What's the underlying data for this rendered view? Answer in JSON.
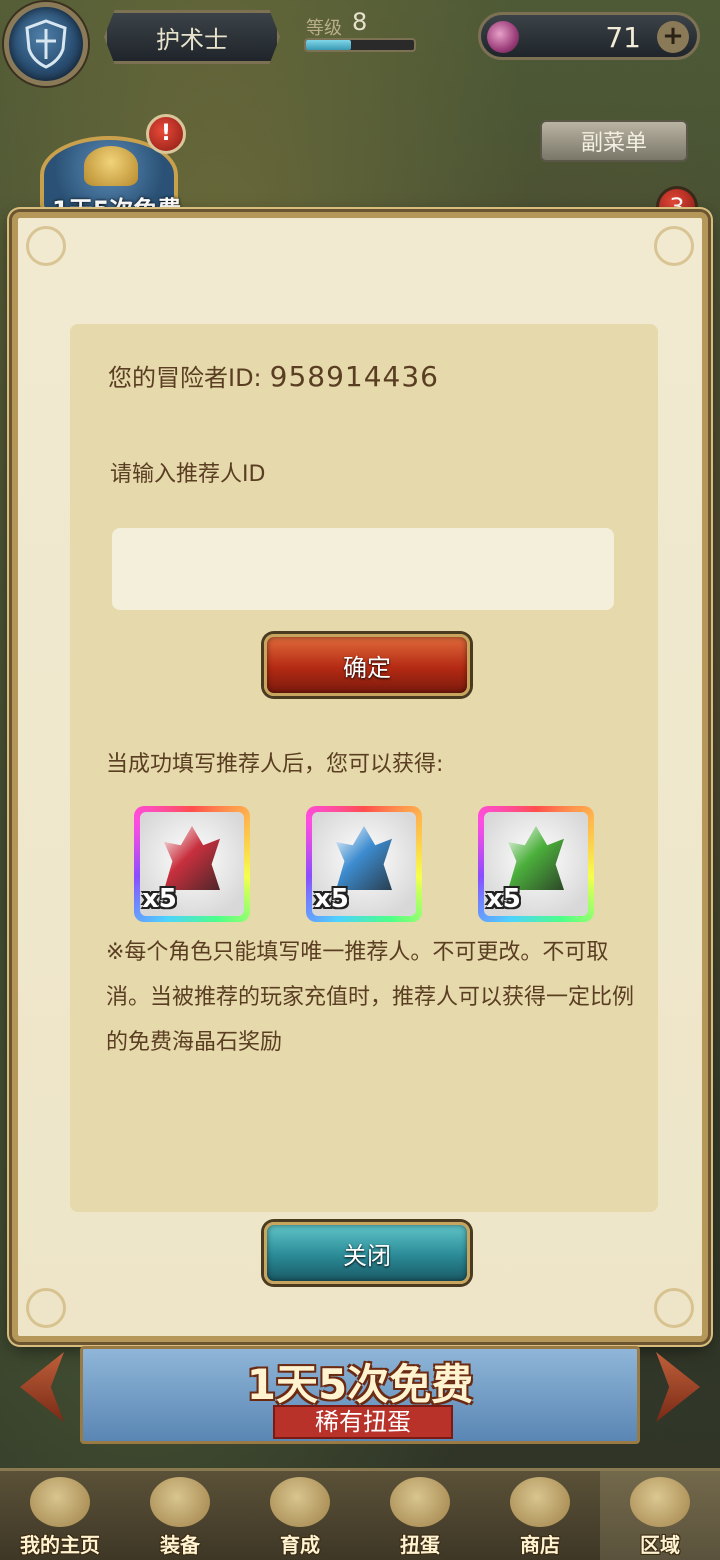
{
  "hud": {
    "player_class": "护术士",
    "level_label": "等级",
    "level_value": "8",
    "level_progress": 0.42,
    "gem_count": "71",
    "gem_add_symbol": "+",
    "free_badge": "1天5次免费",
    "alert_symbol": "!",
    "submenu_label": "副菜单",
    "notification_count": "3"
  },
  "referral": {
    "id_label": "您的冒险者ID:",
    "id_value": "958914436",
    "input_label": "请输入推荐人ID",
    "input_value": "",
    "input_placeholder": "",
    "confirm_label": "确定",
    "reward_intro": "当成功填写推荐人后，您可以获得:",
    "rewards": [
      {
        "name": "red-crystal",
        "quantity": "x5",
        "color": "#c8303e"
      },
      {
        "name": "blue-crystal",
        "quantity": "x5",
        "color": "#3d8ccf"
      },
      {
        "name": "green-crystal",
        "quantity": "x5",
        "color": "#4cb03c"
      }
    ],
    "note": "※每个角色只能填写唯一推荐人。不可更改。不可取消。当被推荐的玩家充值时，推荐人可以获得一定比例的免费海晶石奖励",
    "close_label": "关闭"
  },
  "banner": {
    "title": "1天5次免费",
    "subtitle": "稀有扭蛋"
  },
  "nav": {
    "items": [
      {
        "label": "我的主页",
        "active": false
      },
      {
        "label": "装备",
        "active": false
      },
      {
        "label": "育成",
        "active": false
      },
      {
        "label": "扭蛋",
        "active": false
      },
      {
        "label": "商店",
        "active": false
      },
      {
        "label": "区域",
        "active": true
      }
    ]
  },
  "colors": {
    "accent_gold": "#b6975a",
    "confirm_red": "#b42a14",
    "close_teal": "#2a8a96",
    "text_brown": "#5a3e22"
  }
}
